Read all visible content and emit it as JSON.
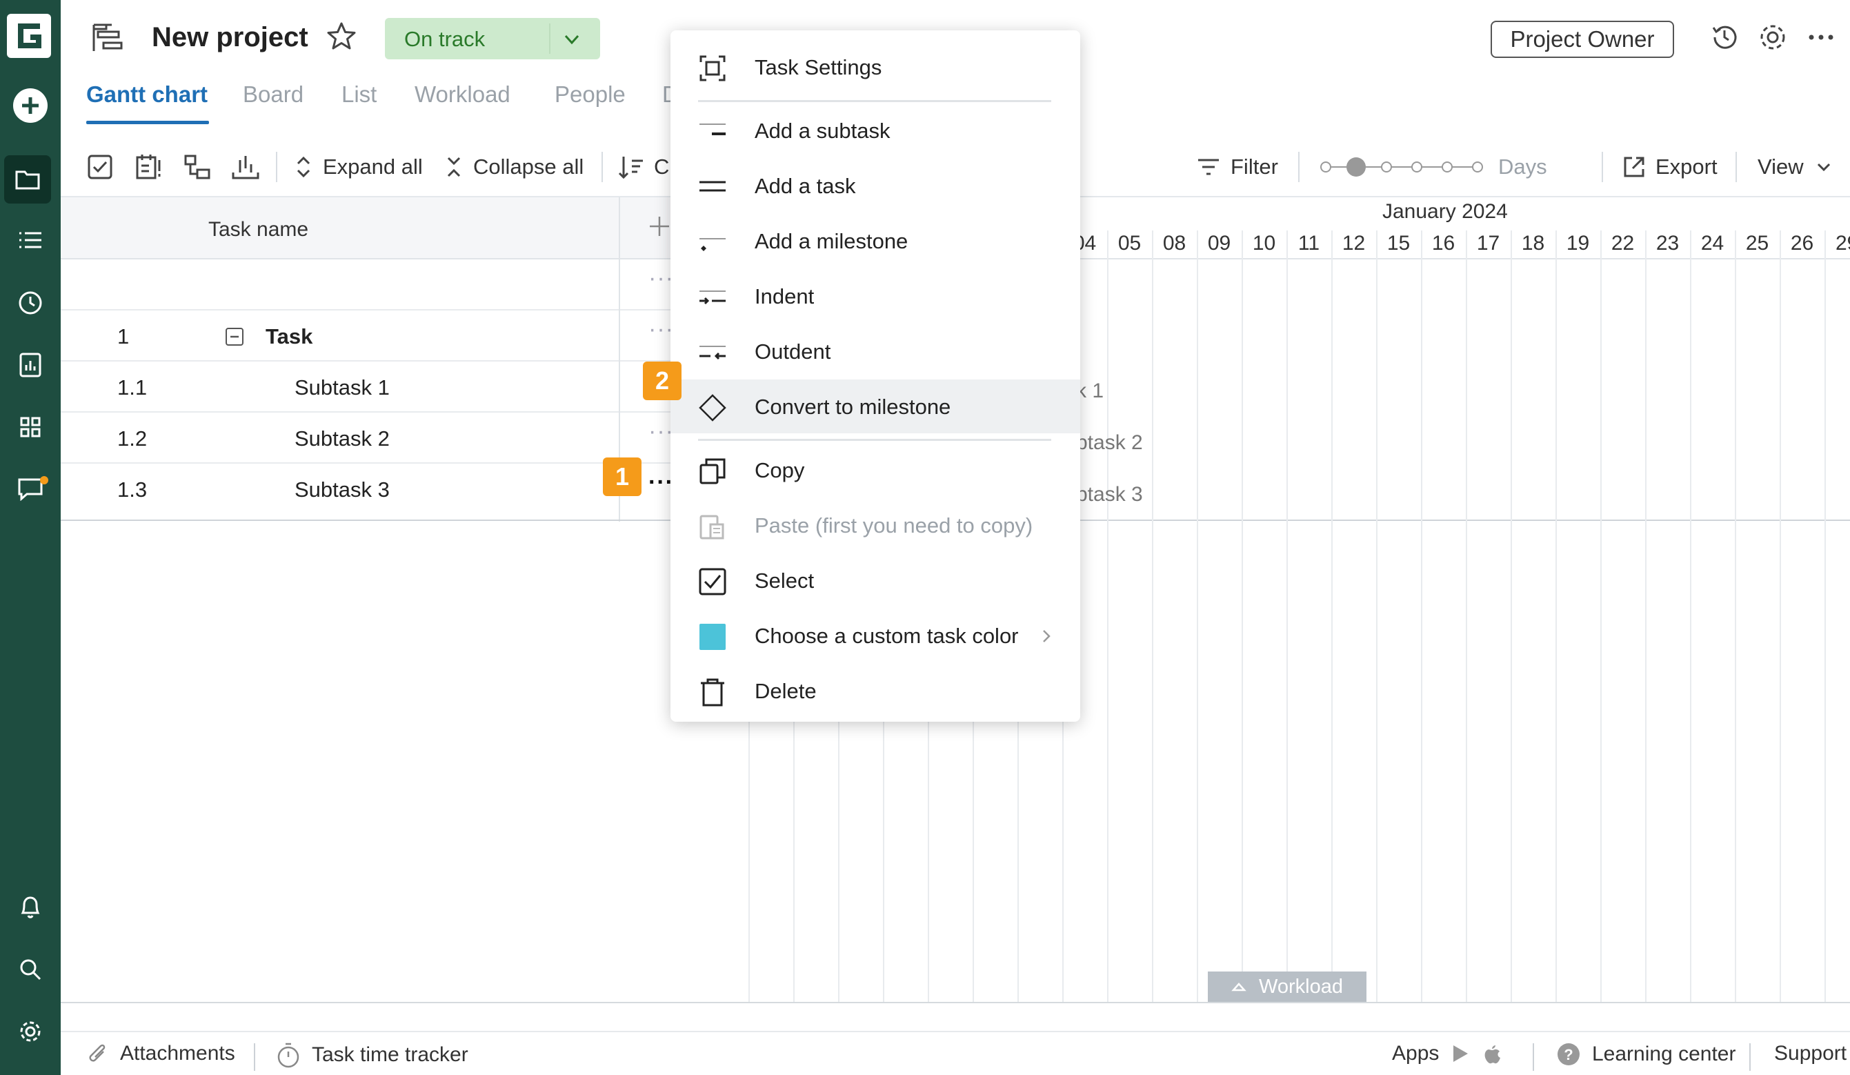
{
  "header": {
    "title": "New project",
    "status": "On track",
    "role": "Project Owner"
  },
  "tabs": [
    "Gantt chart",
    "Board",
    "List",
    "Workload",
    "People",
    "D"
  ],
  "toolbar": {
    "expand_all": "Expand all",
    "collapse_all": "Collapse all",
    "sort": "C",
    "filter": "Filter",
    "scale": "Days",
    "export": "Export",
    "view": "View"
  },
  "grid": {
    "task_name_header": "Task name",
    "rows": [
      {
        "num": "",
        "name": ""
      },
      {
        "num": "1",
        "name": "Task"
      },
      {
        "num": "1.1",
        "name": "Subtask 1"
      },
      {
        "num": "1.2",
        "name": "Subtask 2"
      },
      {
        "num": "1.3",
        "name": "Subtask 3"
      }
    ]
  },
  "timeline": {
    "month": "January 2024",
    "days": [
      "04",
      "05",
      "08",
      "09",
      "10",
      "11",
      "12",
      "15",
      "16",
      "17",
      "18",
      "19",
      "22",
      "23",
      "24",
      "25",
      "26",
      "29"
    ],
    "bar_labels": [
      "k 1",
      "btask 2",
      "btask 3"
    ],
    "workload_tab": "Workload"
  },
  "menu": {
    "items": [
      "Task Settings",
      "Add a subtask",
      "Add a task",
      "Add a milestone",
      "Indent",
      "Outdent",
      "Convert to milestone",
      "Copy",
      "Paste (first you need to copy)",
      "Select",
      "Choose a custom task color",
      "Delete"
    ],
    "swatch_color": "#4cc3d9"
  },
  "badges": [
    "1",
    "2"
  ],
  "footer": {
    "attachments": "Attachments",
    "time_tracker": "Task time tracker",
    "apps": "Apps",
    "learning": "Learning center",
    "support": "Support"
  },
  "colors": {
    "sidebar": "#1e4d40",
    "accent": "#1f6fb5",
    "badge": "#f59b1a",
    "status_bg": "#cdeacd"
  }
}
